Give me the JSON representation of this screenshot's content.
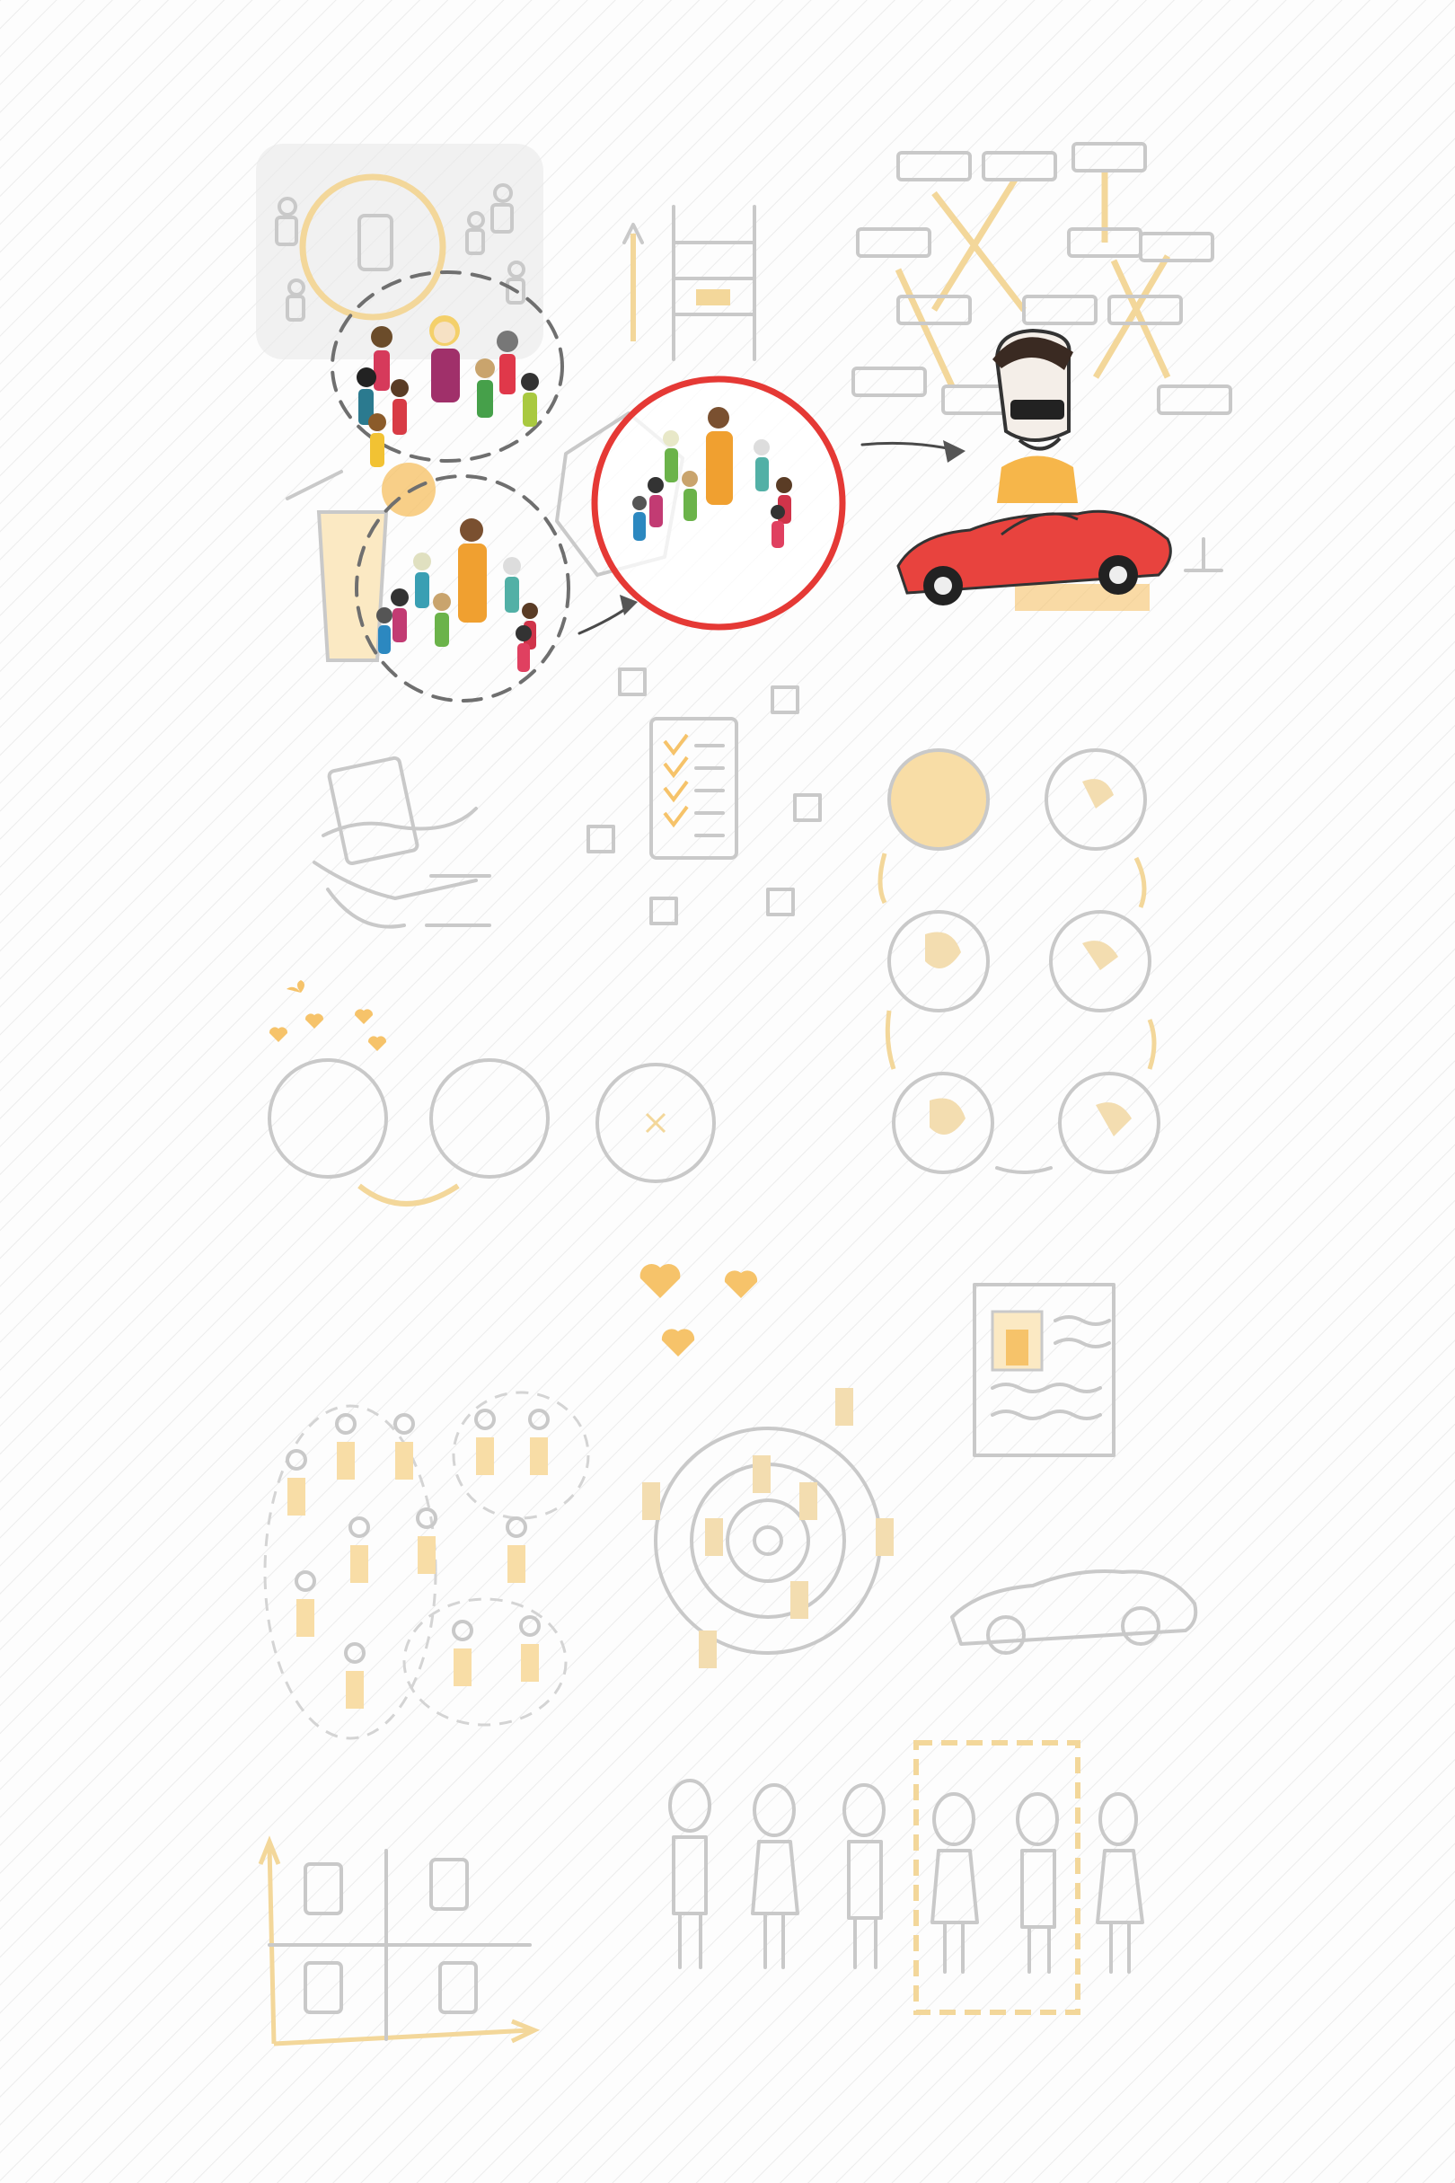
{
  "colors": {
    "background": "#fdfdfd",
    "hatch": "#e8e8e8",
    "sketch_gray": "#c9c9c9",
    "accent_orange": "#f6c36a",
    "highlight_red": "#e53935",
    "car_red": "#e8433e",
    "dash_gray": "#6f6f6f"
  },
  "panels": [
    {
      "name": "crowd-with-groups",
      "state": "highlighted"
    },
    {
      "name": "ladder-ranking",
      "state": "faded"
    },
    {
      "name": "selected-group",
      "state": "emphasized"
    },
    {
      "name": "network-to-success",
      "state": "highlighted"
    },
    {
      "name": "ticket-in-hand",
      "state": "faded"
    },
    {
      "name": "checklist",
      "state": "faded"
    },
    {
      "name": "cycle-of-globes",
      "state": "faded"
    },
    {
      "name": "three-circles",
      "state": "faded"
    },
    {
      "name": "grouped-people",
      "state": "faded"
    },
    {
      "name": "target-with-hearts",
      "state": "faded"
    },
    {
      "name": "profile-card-and-car",
      "state": "faded"
    },
    {
      "name": "quadrant-chart",
      "state": "faded"
    },
    {
      "name": "lineup-selection",
      "state": "faded"
    }
  ],
  "icons": [
    "crowd-icon",
    "ladder-icon",
    "target-circle-icon",
    "network-icon",
    "businessman-icon",
    "sports-car-icon",
    "ticket-icon",
    "checklist-icon",
    "globe-icon",
    "heart-icon",
    "target-icon",
    "profile-card-icon",
    "quadrant-icon",
    "person-icon",
    "arrow-icon",
    "lemonade-icon"
  ]
}
